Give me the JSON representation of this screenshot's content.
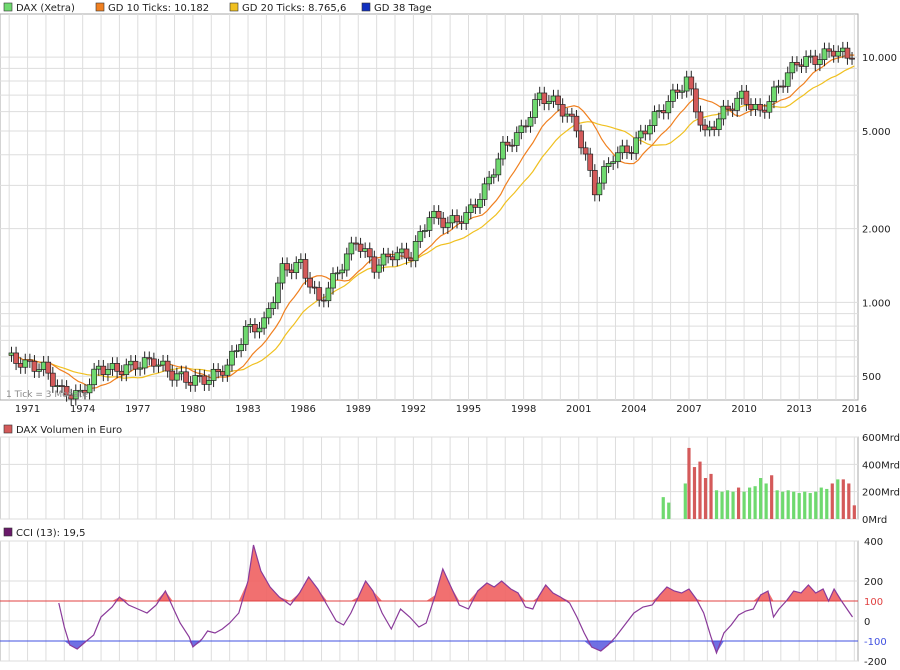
{
  "colors": {
    "up": "#6fd96f",
    "down": "#d45a5a",
    "gd10": "#f08020",
    "gd20": "#f0c020",
    "gd38": "#1030c0",
    "cci_line": "#8a3a9a",
    "cci_pos_fill": "#f06060",
    "cci_neg_fill": "#6060e0",
    "line100": "#e04040",
    "lineM100": "#4050e0",
    "grid": "#dddddd"
  },
  "legend": {
    "dax": "DAX (Xetra)",
    "gd10": "GD 10 Ticks: 10.182",
    "gd20": "GD 20 Ticks: 8.765,6",
    "gd38": "GD 38 Tage"
  },
  "note": "1 Tick = 3 Monate",
  "panels": {
    "volume_title": "DAX Volumen in Euro",
    "cci_title": "CCI (13): 19,5"
  },
  "chart_data": [
    {
      "type": "line",
      "scale": "log",
      "series_name": "DAX (Xetra)",
      "x_ticks": [
        "1971",
        "1974",
        "1977",
        "1980",
        "1983",
        "1986",
        "1989",
        "1992",
        "1995",
        "1998",
        "2001",
        "2004",
        "2007",
        "2010",
        "2013",
        "2016"
      ],
      "y_ticks": [
        "500",
        "1.000",
        "2.000",
        "5.000",
        "10.000"
      ],
      "y_tick_values": [
        500,
        1000,
        2000,
        5000,
        10000
      ],
      "x_range": [
        1969.5,
        2016.2
      ],
      "y_range": [
        400,
        15000
      ],
      "year_values": {
        "1970": 600,
        "1971": 560,
        "1972": 540,
        "1973": 430,
        "1974": 420,
        "1975": 540,
        "1976": 530,
        "1977": 555,
        "1978": 580,
        "1979": 510,
        "1980": 480,
        "1981": 490,
        "1982": 550,
        "1983": 770,
        "1984": 820,
        "1985": 1360,
        "1986": 1430,
        "1987": 1000,
        "1988": 1330,
        "1989": 1790,
        "1990": 1400,
        "1991": 1580,
        "1992": 1550,
        "1993": 2270,
        "1994": 2100,
        "1995": 2250,
        "1996": 2890,
        "1997": 4250,
        "1998": 5000,
        "1999": 6960,
        "2000": 6430,
        "2001": 5160,
        "2002": 2890,
        "2003": 3970,
        "2004": 4260,
        "2005": 5410,
        "2006": 6600,
        "2007": 8070,
        "2008": 4810,
        "2009": 5960,
        "2010": 6910,
        "2011": 5900,
        "2012": 7610,
        "2013": 9550,
        "2014": 9800,
        "2015": 10700,
        "2016": 9900
      },
      "gd10_last": 10182,
      "gd20_last": 8765.6
    },
    {
      "type": "bar",
      "series_name": "DAX Volumen in Euro",
      "y_ticks": [
        "0Mrd",
        "200Mrd",
        "400Mrd",
        "600Mrd"
      ],
      "y_range": [
        0,
        600
      ],
      "x_range": [
        1969.5,
        2016.2
      ],
      "bars": [
        {
          "year": 2005.6,
          "v": 160,
          "up": true
        },
        {
          "year": 2005.9,
          "v": 120,
          "up": true
        },
        {
          "year": 2006.8,
          "v": 260,
          "up": true
        },
        {
          "year": 2007.0,
          "v": 520,
          "up": false
        },
        {
          "year": 2007.3,
          "v": 380,
          "up": false
        },
        {
          "year": 2007.6,
          "v": 420,
          "up": false
        },
        {
          "year": 2007.9,
          "v": 300,
          "up": false
        },
        {
          "year": 2008.2,
          "v": 330,
          "up": false
        },
        {
          "year": 2008.5,
          "v": 210,
          "up": true
        },
        {
          "year": 2008.8,
          "v": 200,
          "up": true
        },
        {
          "year": 2009.1,
          "v": 210,
          "up": true
        },
        {
          "year": 2009.4,
          "v": 200,
          "up": true
        },
        {
          "year": 2009.7,
          "v": 230,
          "up": false
        },
        {
          "year": 2010.0,
          "v": 200,
          "up": true
        },
        {
          "year": 2010.3,
          "v": 230,
          "up": true
        },
        {
          "year": 2010.6,
          "v": 240,
          "up": true
        },
        {
          "year": 2010.9,
          "v": 300,
          "up": true
        },
        {
          "year": 2011.2,
          "v": 260,
          "up": true
        },
        {
          "year": 2011.5,
          "v": 320,
          "up": false
        },
        {
          "year": 2011.8,
          "v": 210,
          "up": true
        },
        {
          "year": 2012.1,
          "v": 200,
          "up": true
        },
        {
          "year": 2012.4,
          "v": 210,
          "up": true
        },
        {
          "year": 2012.7,
          "v": 200,
          "up": true
        },
        {
          "year": 2013.0,
          "v": 190,
          "up": true
        },
        {
          "year": 2013.3,
          "v": 200,
          "up": true
        },
        {
          "year": 2013.6,
          "v": 190,
          "up": true
        },
        {
          "year": 2013.9,
          "v": 200,
          "up": true
        },
        {
          "year": 2014.2,
          "v": 230,
          "up": true
        },
        {
          "year": 2014.5,
          "v": 220,
          "up": true
        },
        {
          "year": 2014.8,
          "v": 260,
          "up": false
        },
        {
          "year": 2015.1,
          "v": 290,
          "up": true
        },
        {
          "year": 2015.4,
          "v": 290,
          "up": false
        },
        {
          "year": 2015.7,
          "v": 260,
          "up": false
        },
        {
          "year": 2016.0,
          "v": 100,
          "up": false
        }
      ]
    },
    {
      "type": "area",
      "series_name": "CCI (13): 19,5",
      "y_ticks": [
        "400",
        "200",
        "100",
        "0",
        "-100",
        "-200"
      ],
      "y_tick_values": [
        400,
        200,
        100,
        0,
        -100,
        -200
      ],
      "y_range": [
        -200,
        400
      ],
      "x_range": [
        1969.5,
        2016.2
      ],
      "threshold_upper": 100,
      "threshold_lower": -100,
      "points": [
        [
          1972.7,
          90
        ],
        [
          1973.0,
          -30
        ],
        [
          1973.3,
          -120
        ],
        [
          1973.7,
          -140
        ],
        [
          1974.2,
          -100
        ],
        [
          1974.6,
          -70
        ],
        [
          1975.0,
          20
        ],
        [
          1975.6,
          70
        ],
        [
          1976.0,
          120
        ],
        [
          1976.5,
          80
        ],
        [
          1977.0,
          60
        ],
        [
          1977.5,
          40
        ],
        [
          1978.0,
          80
        ],
        [
          1978.5,
          150
        ],
        [
          1978.9,
          70
        ],
        [
          1979.3,
          -10
        ],
        [
          1979.8,
          -80
        ],
        [
          1980.0,
          -130
        ],
        [
          1980.5,
          -90
        ],
        [
          1980.8,
          -50
        ],
        [
          1981.2,
          -60
        ],
        [
          1981.6,
          -40
        ],
        [
          1982.0,
          -10
        ],
        [
          1982.5,
          40
        ],
        [
          1983.0,
          200
        ],
        [
          1983.3,
          380
        ],
        [
          1983.7,
          250
        ],
        [
          1984.2,
          170
        ],
        [
          1984.7,
          120
        ],
        [
          1985.3,
          80
        ],
        [
          1985.8,
          140
        ],
        [
          1986.3,
          220
        ],
        [
          1986.8,
          160
        ],
        [
          1987.3,
          80
        ],
        [
          1987.8,
          0
        ],
        [
          1988.2,
          -20
        ],
        [
          1988.6,
          40
        ],
        [
          1989.0,
          120
        ],
        [
          1989.4,
          200
        ],
        [
          1989.8,
          150
        ],
        [
          1990.3,
          40
        ],
        [
          1990.8,
          -40
        ],
        [
          1991.3,
          60
        ],
        [
          1991.8,
          20
        ],
        [
          1992.3,
          -30
        ],
        [
          1992.7,
          -10
        ],
        [
          1993.2,
          130
        ],
        [
          1993.6,
          260
        ],
        [
          1994.0,
          180
        ],
        [
          1994.5,
          80
        ],
        [
          1995.0,
          60
        ],
        [
          1995.5,
          150
        ],
        [
          1996.0,
          190
        ],
        [
          1996.4,
          170
        ],
        [
          1996.8,
          200
        ],
        [
          1997.3,
          160
        ],
        [
          1997.7,
          140
        ],
        [
          1998.1,
          70
        ],
        [
          1998.5,
          60
        ],
        [
          1998.8,
          120
        ],
        [
          1999.2,
          180
        ],
        [
          1999.6,
          140
        ],
        [
          2000.0,
          120
        ],
        [
          2000.5,
          90
        ],
        [
          2000.9,
          20
        ],
        [
          2001.3,
          -60
        ],
        [
          2001.7,
          -130
        ],
        [
          2002.2,
          -150
        ],
        [
          2002.6,
          -120
        ],
        [
          2003.0,
          -80
        ],
        [
          2003.5,
          -20
        ],
        [
          2004.0,
          40
        ],
        [
          2004.5,
          70
        ],
        [
          2005.0,
          80
        ],
        [
          2005.4,
          130
        ],
        [
          2005.8,
          170
        ],
        [
          2006.2,
          150
        ],
        [
          2006.6,
          140
        ],
        [
          2007.0,
          160
        ],
        [
          2007.4,
          110
        ],
        [
          2007.8,
          40
        ],
        [
          2008.2,
          -80
        ],
        [
          2008.5,
          -160
        ],
        [
          2008.9,
          -60
        ],
        [
          2009.3,
          -20
        ],
        [
          2009.7,
          30
        ],
        [
          2010.1,
          50
        ],
        [
          2010.5,
          60
        ],
        [
          2010.9,
          130
        ],
        [
          2011.3,
          150
        ],
        [
          2011.6,
          20
        ],
        [
          2011.9,
          60
        ],
        [
          2012.3,
          100
        ],
        [
          2012.7,
          150
        ],
        [
          2013.1,
          140
        ],
        [
          2013.5,
          180
        ],
        [
          2013.9,
          140
        ],
        [
          2014.3,
          160
        ],
        [
          2014.6,
          100
        ],
        [
          2014.9,
          160
        ],
        [
          2015.3,
          100
        ],
        [
          2015.6,
          60
        ],
        [
          2015.9,
          20
        ]
      ]
    }
  ]
}
